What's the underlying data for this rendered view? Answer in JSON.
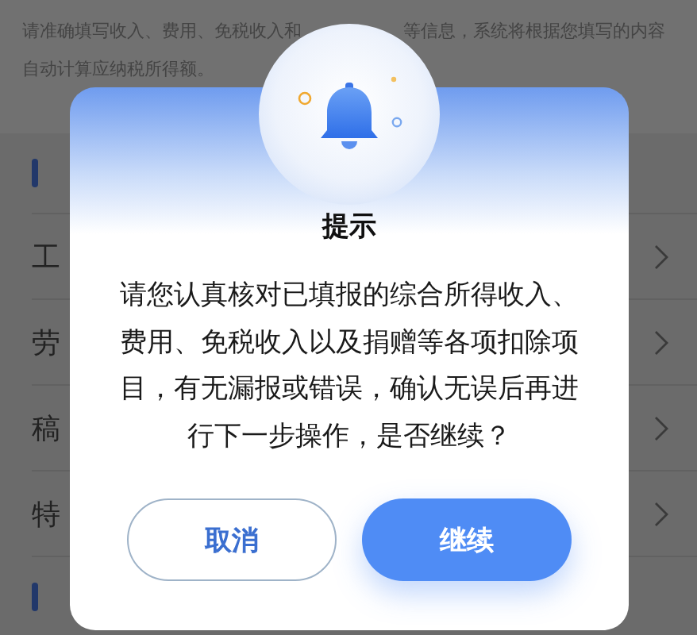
{
  "intro": {
    "line1_left": "请准确填写收入、费用、免税收入和",
    "line1_right": "等信息，系统将根据您填写的内容",
    "line2": "自动计算应纳税所得额。"
  },
  "rows": [
    {
      "label": "工"
    },
    {
      "label": "劳"
    },
    {
      "label": "稿"
    },
    {
      "label": "特"
    }
  ],
  "dialog": {
    "title": "提示",
    "message": "请您认真核对已填报的综合所得收入、费用、免税收入以及捐赠等各项扣除项目，有无漏报或错误，确认无误后再进行下一步操作，是否继续？",
    "buttons": [
      {
        "label": "取消",
        "kind": "secondary"
      },
      {
        "label": "继续",
        "kind": "primary"
      }
    ]
  }
}
